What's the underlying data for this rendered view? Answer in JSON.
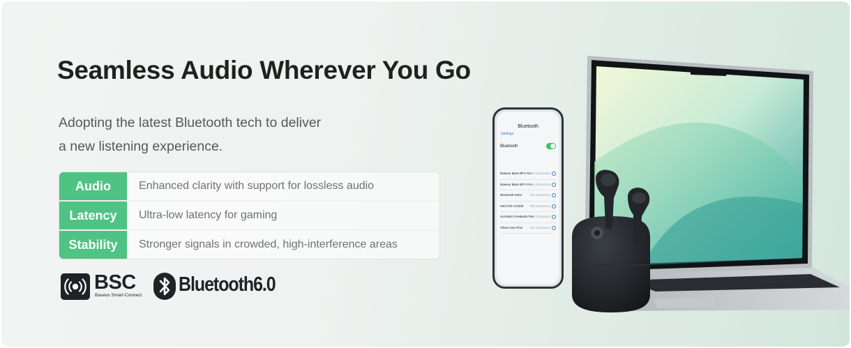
{
  "headline": "Seamless Audio Wherever You Go",
  "subtitle_lines": [
    "Adopting the latest Bluetooth tech to deliver",
    "a new listening experience."
  ],
  "specs": [
    {
      "label": "Audio",
      "value": "Enhanced clarity with support for lossless audio"
    },
    {
      "label": "Latency",
      "value": "Ultra-low latency for gaming"
    },
    {
      "label": "Stability",
      "value": "Stronger signals in crowded, high-interference areas"
    }
  ],
  "logos": {
    "bsc": {
      "text": "BSC",
      "caption": "Baseus Smart-Connect",
      "icon": "signal-broadcast-icon"
    },
    "bluetooth": {
      "text": "Bluetooth6.0",
      "icon": "bluetooth-icon"
    }
  },
  "phone": {
    "title": "Bluetooth",
    "back_label": "Settings",
    "toggle_label": "Bluetooth",
    "devices": [
      {
        "name": "Baseus Bass BP1 NC",
        "status": "Not Connected"
      },
      {
        "name": "Baseus Bass BP1 Pro",
        "status": "Not Connected"
      },
      {
        "name": "Bluetooth-5322",
        "status": "Not Connected"
      },
      {
        "name": "HECATE G1000",
        "status": "Not Connected"
      },
      {
        "name": "HUAWEI FreeBuds Pro",
        "status": "Not Connected"
      },
      {
        "name": "Ofone Sea Plus",
        "status": "Not Connected"
      }
    ]
  },
  "colors": {
    "accent_green": "#4fc383",
    "headline": "#1e2320",
    "body_text": "#55595a",
    "logo_dark": "#1f2226",
    "product_black": "#1c1f22"
  }
}
